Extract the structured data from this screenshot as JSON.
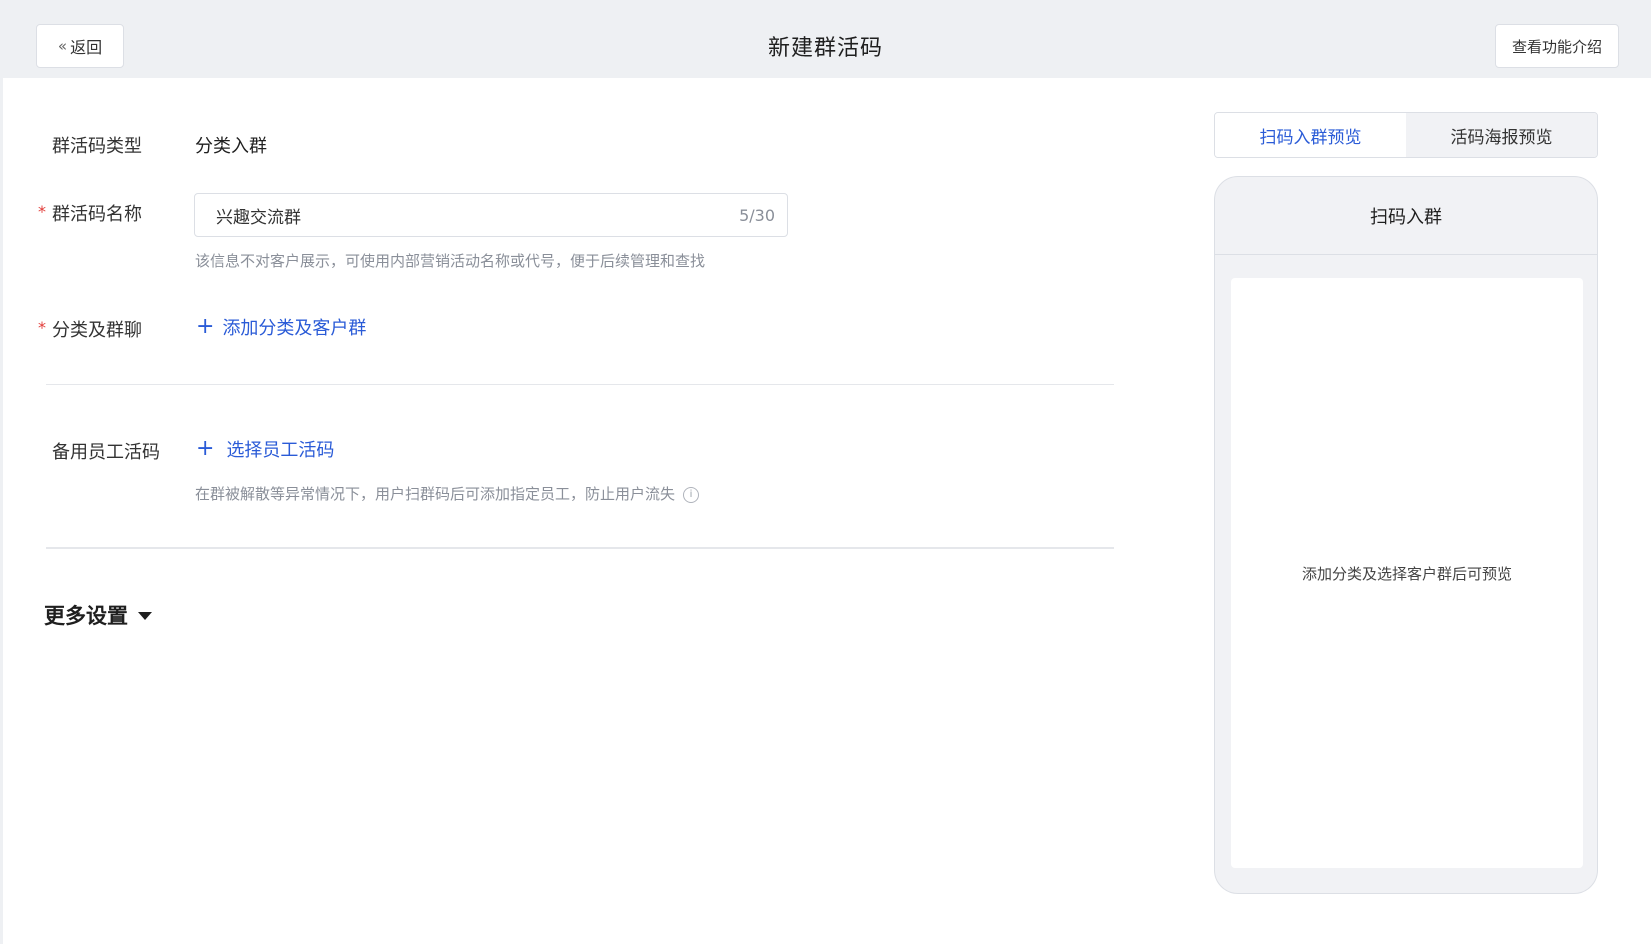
{
  "header": {
    "back_label": "返回",
    "title": "新建群活码",
    "intro_label": "查看功能介绍"
  },
  "form": {
    "type": {
      "label": "群活码类型",
      "value": "分类入群"
    },
    "name": {
      "required_mark": "*",
      "label": "群活码名称",
      "value": "兴趣交流群",
      "count": "5/30",
      "hint": "该信息不对客户展示，可使用内部营销活动名称或代号，便于后续管理和查找"
    },
    "category": {
      "required_mark": "*",
      "label": "分类及群聊",
      "add_label": "添加分类及客户群"
    },
    "backup": {
      "label": "备用员工活码",
      "select_label": "选择员工活码",
      "hint": "在群被解散等异常情况下，用户扫群码后可添加指定员工，防止用户流失"
    },
    "more_settings": "更多设置"
  },
  "preview": {
    "tabs": [
      {
        "label": "扫码入群预览",
        "active": true
      },
      {
        "label": "活码海报预览",
        "active": false
      }
    ],
    "phone_title": "扫码入群",
    "empty_text": "添加分类及选择客户群后可预览"
  },
  "colors": {
    "accent": "#2a5bd7",
    "required": "#e23c39",
    "header_bg": "#eef0f3"
  }
}
